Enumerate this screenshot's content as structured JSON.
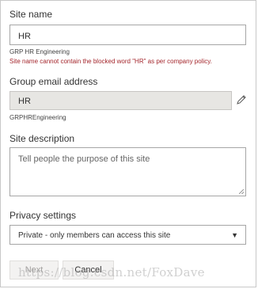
{
  "site_name": {
    "label": "Site name",
    "value": "HR",
    "hint": "GRP HR Engineering",
    "error": "Site name cannot contain the blocked word \"HR\" as per company policy."
  },
  "group_email": {
    "label": "Group email address",
    "value": "HR",
    "hint": "GRPHREngineering",
    "edit_icon": "pencil-icon"
  },
  "site_description": {
    "label": "Site description",
    "placeholder": "Tell people the purpose of this site"
  },
  "privacy": {
    "label": "Privacy settings",
    "selected": "Private - only members can access this site"
  },
  "buttons": {
    "next": "Next",
    "cancel": "Cancel"
  },
  "watermark": "https://blog.csdn.net/FoxDave",
  "colors": {
    "error": "#a4262c",
    "disabled_bg": "#e7e6e3",
    "button_bg": "#f3f2f1"
  }
}
